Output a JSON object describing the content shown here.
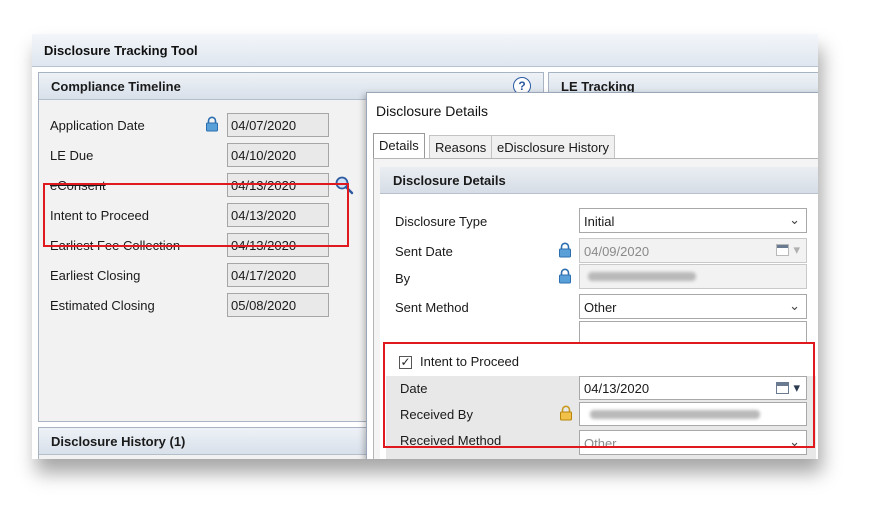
{
  "tool": {
    "title": "Disclosure Tracking Tool"
  },
  "compliance": {
    "title": "Compliance Timeline",
    "help": "?",
    "rows": [
      {
        "label": "Application Date",
        "value": "04/07/2020"
      },
      {
        "label": "LE Due",
        "value": "04/10/2020"
      },
      {
        "label": "eConsent",
        "value": "04/13/2020"
      },
      {
        "label": "Intent to Proceed",
        "value": "04/13/2020"
      },
      {
        "label": "Earliest Fee Collection",
        "value": "04/13/2020"
      },
      {
        "label": "Earliest Closing",
        "value": "04/17/2020"
      },
      {
        "label": "Estimated Closing",
        "value": "05/08/2020"
      }
    ]
  },
  "le_tracking": {
    "title": "LE Tracking"
  },
  "history": {
    "title": "Disclosure History (1)"
  },
  "dialog": {
    "title": "Disclosure Details",
    "tabs": [
      "Details",
      "Reasons",
      "eDisclosure History"
    ],
    "section_title": "Disclosure Details",
    "disclosure_type": {
      "label": "Disclosure Type",
      "value": "Initial"
    },
    "sent_date": {
      "label": "Sent Date",
      "value": "04/09/2020"
    },
    "by": {
      "label": "By"
    },
    "sent_method": {
      "label": "Sent Method",
      "value": "Other"
    },
    "intent": {
      "label": "Intent to Proceed",
      "checked": true
    },
    "date": {
      "label": "Date",
      "value": "04/13/2020"
    },
    "received_by": {
      "label": "Received By"
    },
    "received_method": {
      "label": "Received Method",
      "value": "Other"
    }
  },
  "colors": {
    "highlight": "#e0191e",
    "accent": "#2c5aa0"
  }
}
